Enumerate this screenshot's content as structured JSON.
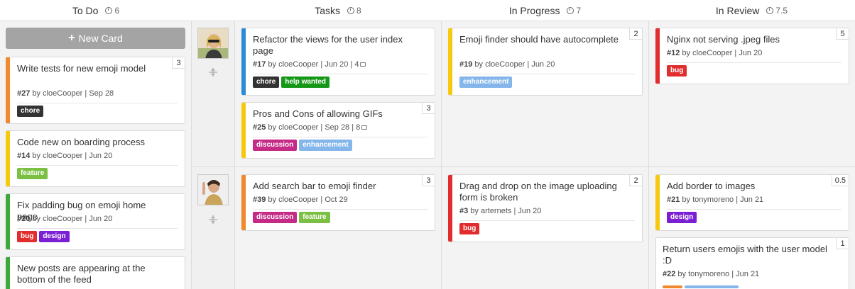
{
  "columns": [
    {
      "name": "To Do",
      "count": "6"
    },
    {
      "name": "Tasks",
      "count": "8"
    },
    {
      "name": "In Progress",
      "count": "7"
    },
    {
      "name": "In Review",
      "count": "7.5"
    }
  ],
  "new_card_label": "New Card",
  "colors": {
    "chore": "#333333",
    "feature": "#7bc043",
    "bug": "#e12d2d",
    "design": "#7a1fd4",
    "discussion": "#c52a87",
    "enhancement": "#84b6eb",
    "help_wanted": "#159818"
  },
  "cards": {
    "todo": [
      {
        "title": "Write tests for new emoji model",
        "num": "#27",
        "meta": " by cloeCooper | Sep 28",
        "estimate": "3",
        "stripe": "#f0882d",
        "labels": [
          {
            "text": "chore",
            "color": "#333333"
          }
        ]
      },
      {
        "title": "Code new on boarding process",
        "num": "#14",
        "meta": " by cloeCooper | Jun 20",
        "stripe": "#f6c90e",
        "labels": [
          {
            "text": "feature",
            "color": "#7bc043"
          }
        ]
      },
      {
        "title": "Fix padding bug on emoji home page",
        "num": "#20",
        "meta": " by cloeCooper | Jun 20",
        "stripe": "#3ea83b",
        "labels": [
          {
            "text": "bug",
            "color": "#e12d2d"
          },
          {
            "text": "design",
            "color": "#7a1fd4"
          }
        ]
      },
      {
        "title": "New posts are appearing at the bottom of the feed",
        "stripe": "#3ea83b"
      }
    ],
    "tasks": [
      {
        "title": "Refactor the views for the user index page",
        "num": "#17",
        "meta": " by cloeCooper | Jun 20 | 4",
        "stripe": "#2d8bd6",
        "labels": [
          {
            "text": "chore",
            "color": "#333333"
          },
          {
            "text": "help wanted",
            "color": "#159818"
          }
        ]
      },
      {
        "title": "Pros and Cons of allowing GIFs",
        "num": "#25",
        "meta": " by cloeCooper | Sep 28 | 8",
        "estimate": "3",
        "stripe": "#f6c90e",
        "labels": [
          {
            "text": "discussion",
            "color": "#c52a87"
          },
          {
            "text": "enhancement",
            "color": "#84b6eb"
          }
        ]
      },
      {
        "title": "Add search bar to emoji finder",
        "num": "#39",
        "meta": " by cloeCooper | Oct 29",
        "estimate": "3",
        "stripe": "#f0882d",
        "labels": [
          {
            "text": "discussion",
            "color": "#c52a87"
          },
          {
            "text": "feature",
            "color": "#7bc043"
          }
        ]
      }
    ],
    "progress": [
      {
        "title": "Emoji finder should have autocomplete",
        "num": "#19",
        "meta": " by cloeCooper | Jun 20",
        "estimate": "2",
        "stripe": "#f6c90e",
        "labels": [
          {
            "text": "enhancement",
            "color": "#84b6eb"
          }
        ]
      },
      {
        "title": "Drag and drop on the image uploading form is broken",
        "num": "#3",
        "meta": " by arternets | Jun 20",
        "estimate": "2",
        "stripe": "#e12d2d",
        "labels": [
          {
            "text": "bug",
            "color": "#e12d2d"
          }
        ]
      }
    ],
    "review": [
      {
        "title": "Nginx not serving .jpeg files",
        "num": "#12",
        "meta": " by cloeCooper | Jun 20",
        "estimate": "5",
        "stripe": "#e12d2d",
        "labels": [
          {
            "text": "bug",
            "color": "#e12d2d"
          }
        ]
      },
      {
        "title": "Add border to images",
        "num": "#21",
        "meta": " by tonymoreno | Jun 21",
        "estimate": "0.5",
        "stripe": "#f6c90e",
        "labels": [
          {
            "text": "design",
            "color": "#7a1fd4"
          }
        ]
      },
      {
        "title": "Return users emojis with the user model :D",
        "num": "#22",
        "meta": " by tonymoreno | Jun 21",
        "estimate": "1",
        "stripe": "#ffffff"
      }
    ]
  }
}
